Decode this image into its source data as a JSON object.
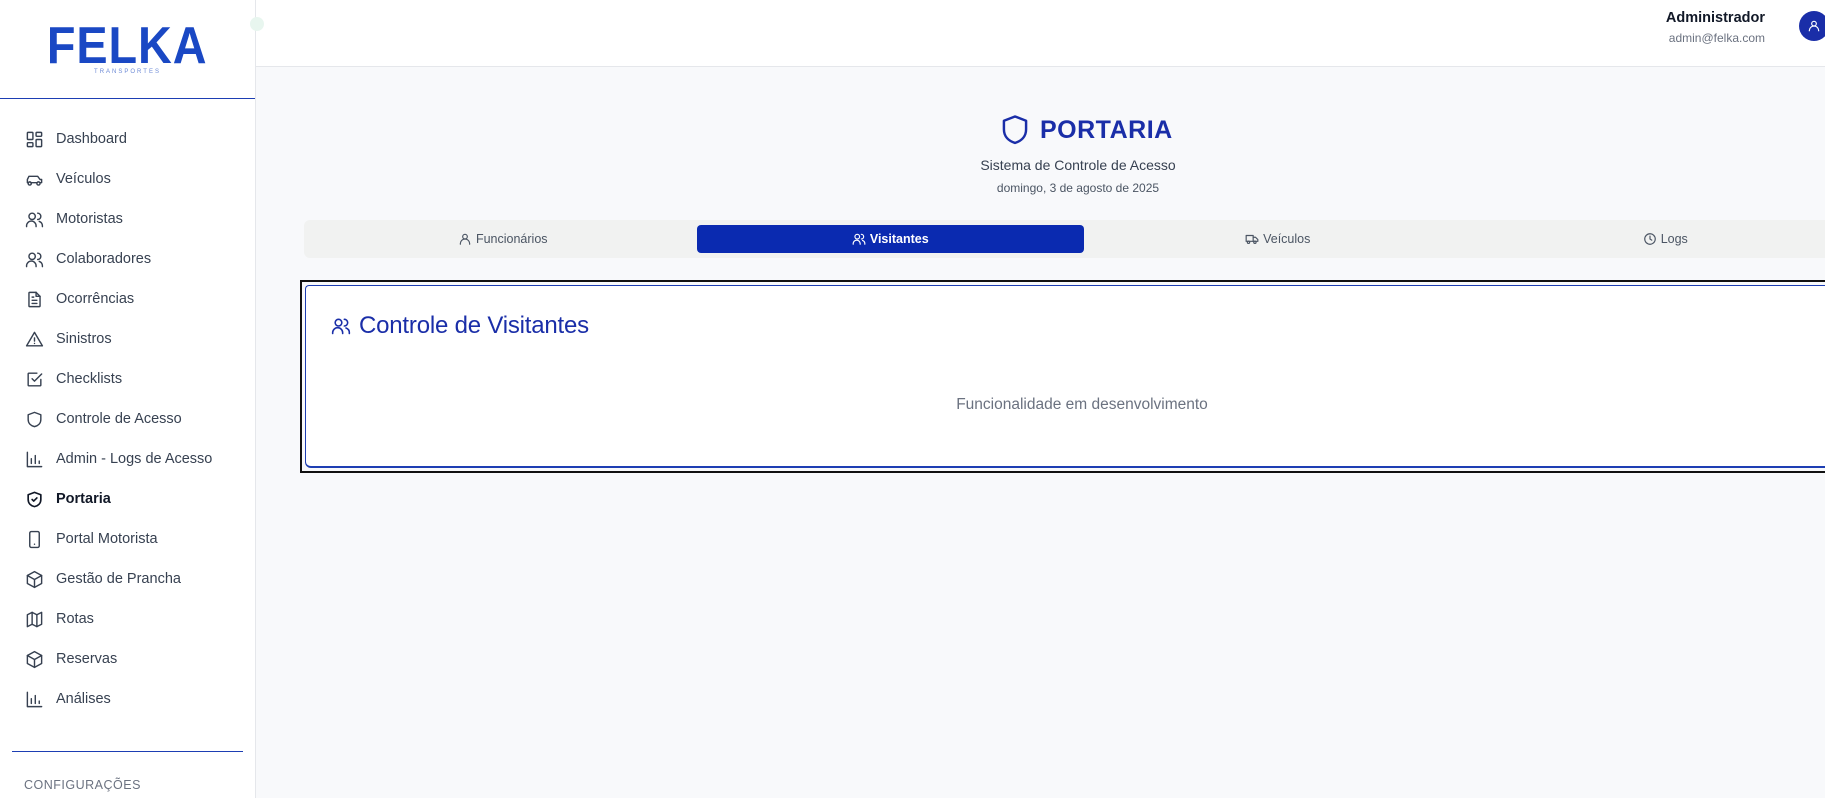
{
  "brand": {
    "logo_text": "FELKA",
    "logo_sub": "TRANSPORTES",
    "logo_color": "#1a48c4"
  },
  "colors": {
    "primary": "#0a2ab0",
    "accent_line": "#1d3eb3"
  },
  "sidebar": {
    "items": [
      {
        "label": "Dashboard",
        "icon": "dashboard-icon"
      },
      {
        "label": "Veículos",
        "icon": "car-icon"
      },
      {
        "label": "Motoristas",
        "icon": "users-icon"
      },
      {
        "label": "Colaboradores",
        "icon": "users-icon"
      },
      {
        "label": "Ocorrências",
        "icon": "document-icon"
      },
      {
        "label": "Sinistros",
        "icon": "warning-icon"
      },
      {
        "label": "Checklists",
        "icon": "checkbox-icon"
      },
      {
        "label": "Controle de Acesso",
        "icon": "shield-icon"
      },
      {
        "label": "Admin - Logs de Acesso",
        "icon": "bar-chart-icon"
      },
      {
        "label": "Portaria",
        "icon": "shield-check-icon",
        "active": true
      },
      {
        "label": "Portal Motorista",
        "icon": "smartphone-icon"
      },
      {
        "label": "Gestão de Prancha",
        "icon": "box-icon"
      },
      {
        "label": "Rotas",
        "icon": "map-icon"
      },
      {
        "label": "Reservas",
        "icon": "box-icon"
      },
      {
        "label": "Análises",
        "icon": "bar-chart-icon"
      }
    ],
    "section_label": "CONFIGURAÇÕES"
  },
  "header": {
    "user_name": "Administrador",
    "user_email": "admin@felka.com",
    "avatar_icon": "user-icon"
  },
  "page": {
    "title": "PORTARIA",
    "title_icon": "shield-icon",
    "subtitle": "Sistema de Controle de Acesso",
    "date": "domingo, 3 de agosto de 2025"
  },
  "tabs": [
    {
      "label": "Funcionários",
      "icon": "user-icon",
      "active": false
    },
    {
      "label": "Visitantes",
      "icon": "users-icon",
      "active": true
    },
    {
      "label": "Veículos",
      "icon": "truck-icon",
      "active": false
    },
    {
      "label": "Logs",
      "icon": "clock-icon",
      "active": false
    }
  ],
  "card": {
    "title": "Controle de Visitantes",
    "title_icon": "users-icon",
    "message": "Funcionalidade em desenvolvimento"
  }
}
